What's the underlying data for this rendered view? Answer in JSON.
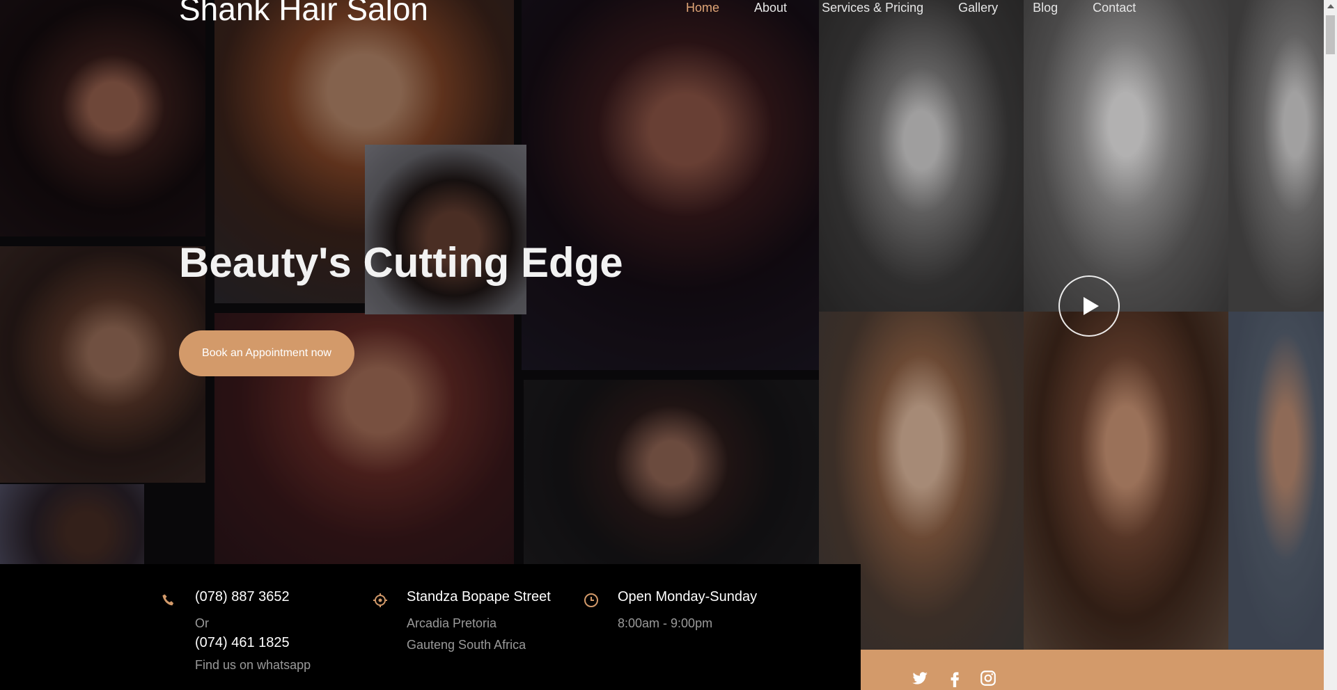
{
  "brand": "Shank Hair Salon",
  "nav": {
    "items": [
      "Home",
      "About",
      "Services & Pricing",
      "Gallery",
      "Blog",
      "Contact"
    ],
    "active": "Home"
  },
  "hero": {
    "title": "Beauty's Cutting Edge",
    "cta": "Book an Appointment now"
  },
  "info": {
    "phone": {
      "icon": "phone-icon",
      "primary": "(078) 887 3652",
      "or": "Or",
      "secondary": "(074) 461 1825",
      "whatsapp": "Find us on whatsapp"
    },
    "address": {
      "icon": "location-icon",
      "street": "Standza Bopape Street",
      "line1": "Arcadia Pretoria",
      "line2": "Gauteng South Africa"
    },
    "hours": {
      "icon": "clock-icon",
      "title": "Open Monday-Sunday",
      "time": "8:00am - 9:00pm"
    }
  },
  "social": [
    "twitter-icon",
    "facebook-icon",
    "instagram-icon"
  ],
  "colors": {
    "accent": "#d39a6a",
    "nav_active": "#e0a577",
    "info_bg": "#000000"
  }
}
